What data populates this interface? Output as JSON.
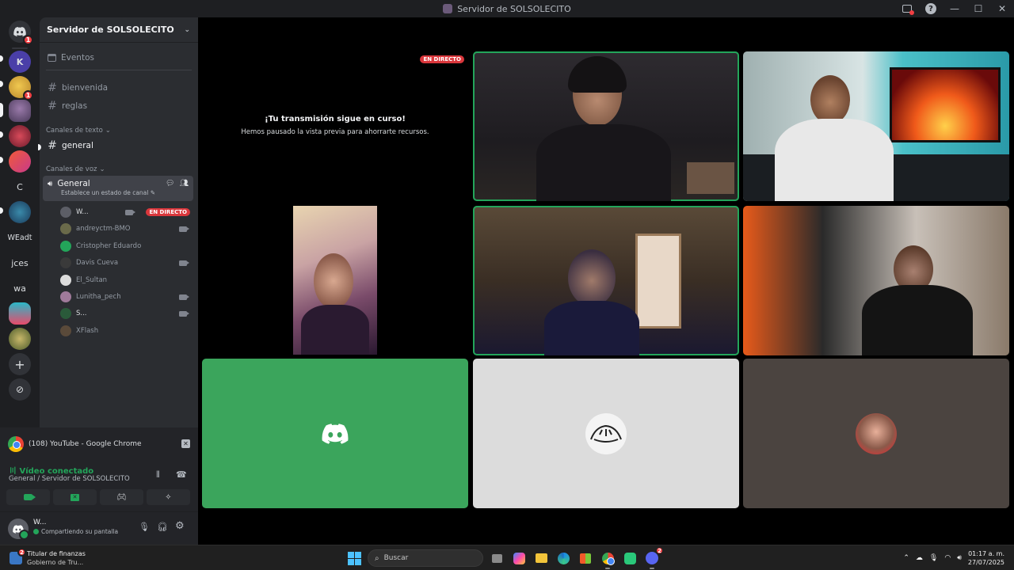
{
  "window": {
    "title": "Servidor de SOLSOLECITO"
  },
  "rail": {
    "items": [
      {
        "kind": "home",
        "badge": "1"
      },
      {
        "kind": "server",
        "label": "K",
        "color": "#4a3fa8"
      },
      {
        "kind": "server",
        "color": "#c9a44a",
        "badge": "1"
      },
      {
        "kind": "server",
        "color": "#6a5a8a"
      },
      {
        "kind": "server",
        "color": "#b3364a"
      },
      {
        "kind": "server",
        "color": "#e8543a"
      },
      {
        "kind": "text",
        "label": "C"
      },
      {
        "kind": "server",
        "color": "#1a6a8a"
      },
      {
        "kind": "text",
        "label": "WEadt"
      },
      {
        "kind": "text",
        "label": "jces"
      },
      {
        "kind": "text",
        "label": "wa"
      },
      {
        "kind": "server",
        "color": "#2aa8b8"
      },
      {
        "kind": "server",
        "color": "#8a9a4a"
      }
    ],
    "add_label": "+",
    "explore_label": "⊘"
  },
  "sidebar": {
    "server_name": "Servidor de SOLSOLECITO",
    "events_label": "Eventos",
    "channels": [
      "bienvenida",
      "reglas"
    ],
    "text_category": "Canales de texto",
    "text_channels": [
      "general"
    ],
    "voice_category": "Canales de voz",
    "voice_channel": {
      "name": "General",
      "status": "Establece un estado de canal"
    },
    "members": [
      {
        "name": "W...",
        "color": "#5c5e66",
        "live": true,
        "camera": true
      },
      {
        "name": "andreyctm-BMO",
        "color": "#6a6a4a",
        "live": false,
        "camera": true
      },
      {
        "name": "Cristopher Eduardo",
        "color": "#23a55a",
        "live": false,
        "camera": false
      },
      {
        "name": "Davis Cueva",
        "color": "#3a3a3a",
        "live": false,
        "camera": true
      },
      {
        "name": "El_Sultan",
        "color": "#dcdcdc",
        "live": false,
        "camera": false
      },
      {
        "name": "Lunitha_pech",
        "color": "#a07a9a",
        "live": false,
        "camera": true
      },
      {
        "name": "S...",
        "color": "#2a5a3a",
        "live": false,
        "camera": true
      },
      {
        "name": "XFlash",
        "color": "#5a4a3a",
        "live": false,
        "camera": false
      }
    ],
    "live_label": "EN DIRECTO"
  },
  "stream_panel": {
    "source": "(108) YouTube - Google Chrome",
    "connected": "Vídeo conectado",
    "path": "General / Servidor de SOLSOLECITO"
  },
  "user_panel": {
    "name": "W...",
    "status": "Compartiendo su pantalla"
  },
  "stage": {
    "live_label": "EN DIRECTO",
    "paused_title": "¡Tu transmisión sigue en curso!",
    "paused_sub": "Hemos pausado la vista previa para ahorrarte recursos."
  },
  "taskbar": {
    "weather_title": "Titular de finanzas",
    "weather_sub": "Gobierno de Tru...",
    "weather_badge": "2",
    "search_placeholder": "Buscar",
    "discord_badge": "2",
    "time": "01:17 a. m.",
    "date": "27/07/2025"
  },
  "colors": {
    "accent_green": "#23a55a",
    "live_red": "#da373c",
    "discord_tile": "#3ba55c"
  }
}
